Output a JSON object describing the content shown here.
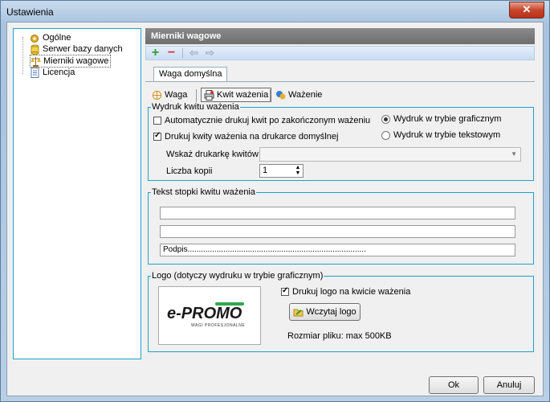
{
  "window": {
    "title": "Ustawienia",
    "close": "✕"
  },
  "tree": {
    "items": [
      {
        "label": "Ogólne"
      },
      {
        "label": "Serwer bazy danych"
      },
      {
        "label": "Mierniki wagowe"
      },
      {
        "label": "Licencja"
      }
    ]
  },
  "panel": {
    "title": "Mierniki wagowe"
  },
  "toolbar": {
    "add": "+",
    "remove": "−",
    "back": "⇦",
    "forward": "⇨"
  },
  "tabs": {
    "active": "Waga domyślna"
  },
  "subtabs": [
    {
      "label": "Waga"
    },
    {
      "label": "Kwit ważenia"
    },
    {
      "label": "Ważenie"
    }
  ],
  "print_group": {
    "title": "Wydruk kwitu ważenia",
    "auto_print": {
      "label": "Automatycznie drukuj kwit po zakończonym ważeniu",
      "checked": false
    },
    "default_printer": {
      "label": "Drukuj kwity ważenia na drukarce domyślnej",
      "checked": true
    },
    "mode_graphic": {
      "label": "Wydruk w trybie graficznym",
      "selected": true
    },
    "mode_text": {
      "label": "Wydruk w trybie tekstowym",
      "selected": false
    },
    "printer_label": "Wskaż drukarkę kwitów",
    "printer_value": "",
    "copies_label": "Liczba kopii",
    "copies_value": "1"
  },
  "footer_group": {
    "title": "Tekst stopki kwitu ważenia",
    "line1": "",
    "line2": "",
    "line3": "Podpis................................................................................"
  },
  "logo_group": {
    "title": "Logo (dotyczy wydruku w trybie graficznym)",
    "logo_text": "e-PROMO",
    "logo_subtext": "WAGI PROFESJONALNE",
    "print_logo": {
      "label": "Drukuj logo na kwicie ważenia",
      "checked": true
    },
    "load_button": "Wczytaj logo",
    "size_info": "Rozmiar pliku: max 500KB"
  },
  "buttons": {
    "ok": "Ok",
    "cancel": "Anuluj"
  },
  "colors": {
    "group_border": "#1ea2cf",
    "header_bg": "#7a7a7a",
    "add_green": "#2e9e2e",
    "remove_red": "#d23a2a"
  }
}
